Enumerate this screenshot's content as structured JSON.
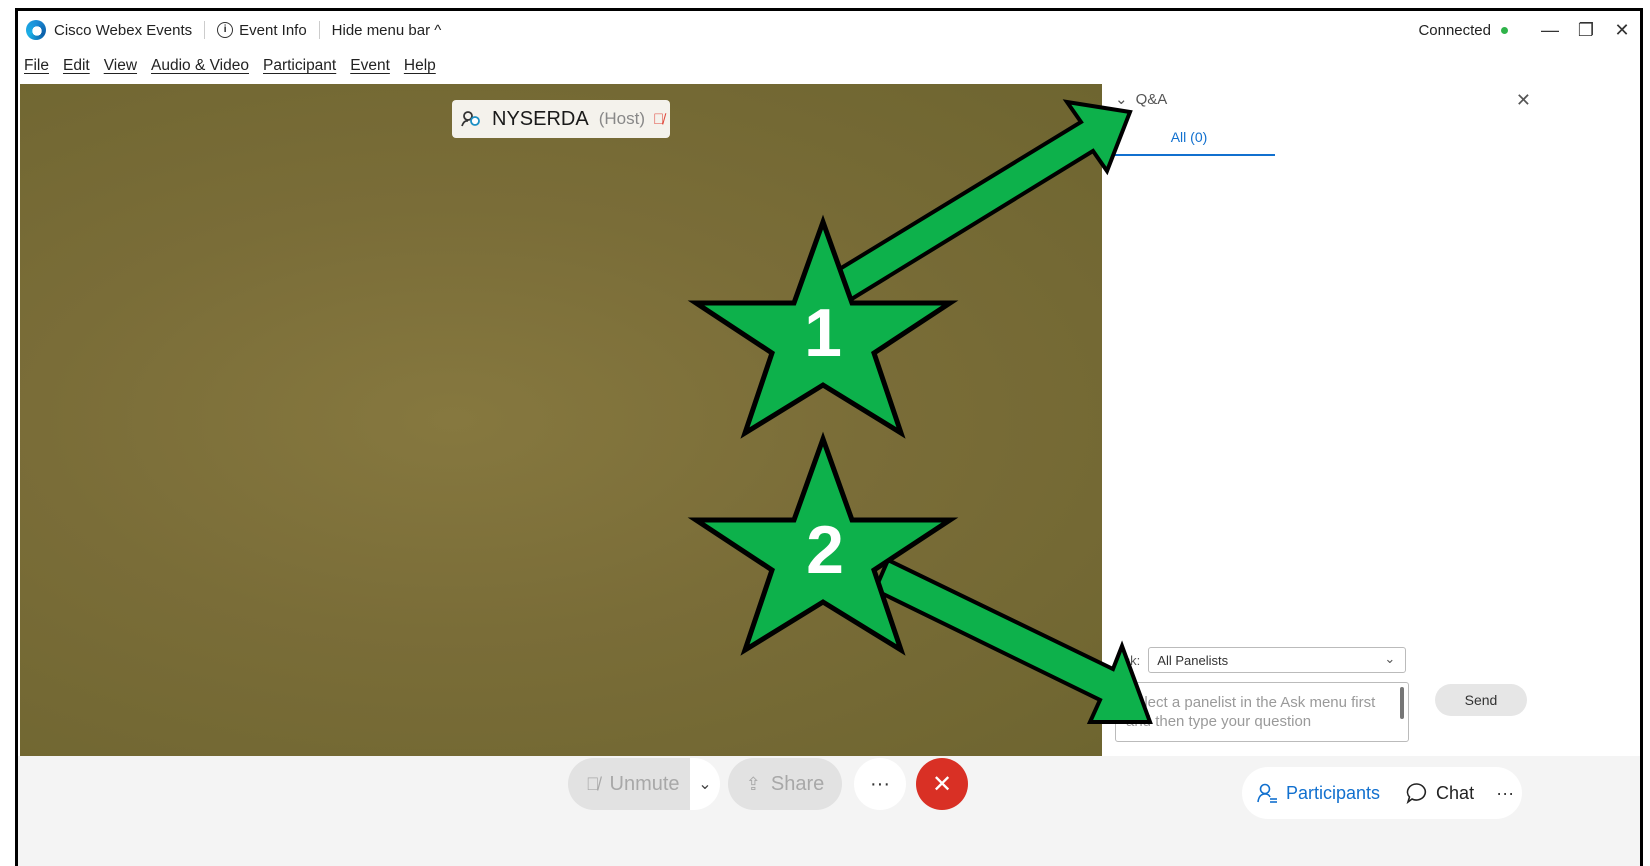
{
  "titlebar": {
    "app_name": "Cisco Webex Events",
    "event_info": "Event Info",
    "hide_menu": "Hide menu bar ^",
    "status": "Connected",
    "minimize": "—",
    "restore": "❐",
    "close": "✕",
    "status_color": "#2fb34a"
  },
  "menu": [
    "File",
    "Edit",
    "View",
    "Audio & Video",
    "Participant",
    "Event",
    "Help"
  ],
  "video": {
    "name": "NYSERDA",
    "role": "(Host)"
  },
  "qa": {
    "title": "Q&A",
    "tab": "All (0)",
    "ask_label": "Ask:",
    "ask_value": "All Panelists",
    "placeholder": "Select a panelist in the Ask menu first and then type your question",
    "send": "Send"
  },
  "controls": {
    "unmute": "Unmute",
    "share": "Share",
    "more": "···",
    "participants": "Participants",
    "chat": "Chat",
    "overflow": "···",
    "end_color": "#d93025"
  },
  "annotations": {
    "star1": "1",
    "star2": "2",
    "color": "#0db14b"
  }
}
